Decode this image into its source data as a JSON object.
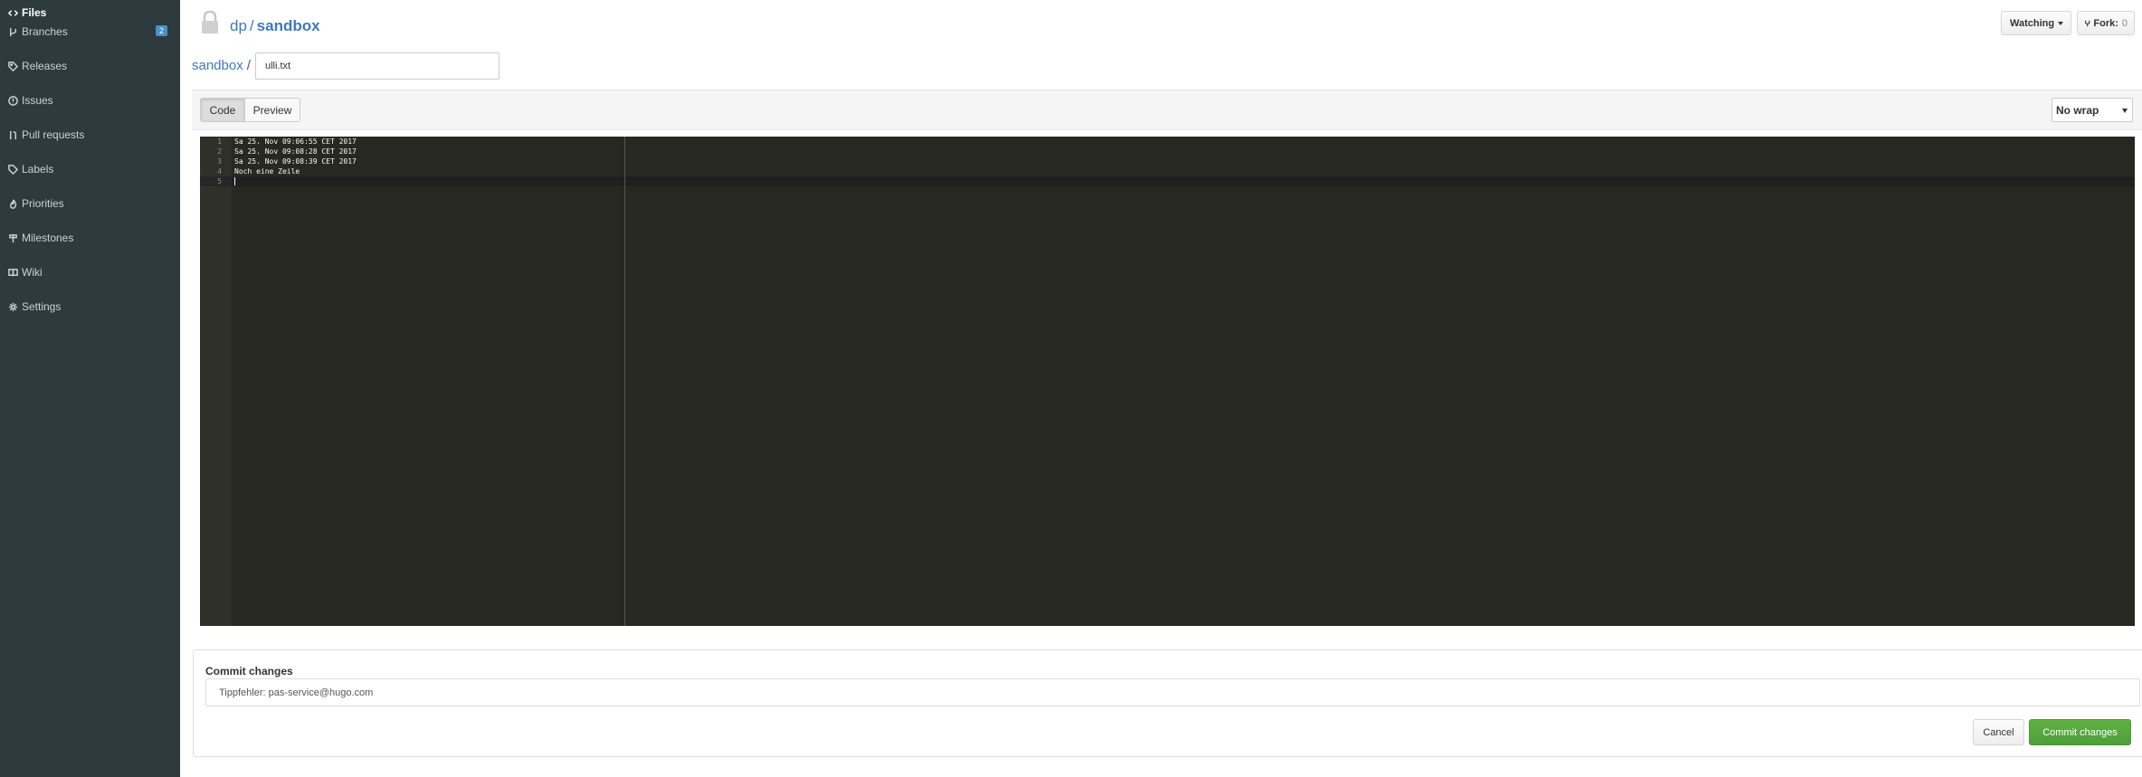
{
  "sidebar": {
    "items": [
      {
        "label": "Files",
        "icon": "code-icon",
        "active": true
      },
      {
        "label": "Branches",
        "icon": "branch-icon",
        "badge": "2"
      },
      {
        "label": "Releases",
        "icon": "tag-icon"
      },
      {
        "label": "Issues",
        "icon": "issue-icon"
      },
      {
        "label": "Pull requests",
        "icon": "pull-request-icon"
      },
      {
        "label": "Labels",
        "icon": "label-icon"
      },
      {
        "label": "Priorities",
        "icon": "flame-icon"
      },
      {
        "label": "Milestones",
        "icon": "milestone-icon"
      },
      {
        "label": "Wiki",
        "icon": "book-icon"
      },
      {
        "label": "Settings",
        "icon": "gear-icon"
      }
    ]
  },
  "header": {
    "owner": "dp",
    "separator": "/",
    "repo": "sandbox",
    "watch_label": "Watching",
    "fork_label": "Fork:",
    "fork_count": "0"
  },
  "file": {
    "breadcrumb_repo": "sandbox",
    "breadcrumb_sep": "/",
    "filename": "ulli.txt"
  },
  "toolbar": {
    "code_tab": "Code",
    "preview_tab": "Preview",
    "wrap_option": "No wrap"
  },
  "editor": {
    "lines": [
      {
        "num": "1",
        "text": "Sa 25. Nov 09:06:55 CET 2017"
      },
      {
        "num": "2",
        "text": "Sa 25. Nov 09:08:28 CET 2017"
      },
      {
        "num": "3",
        "text": "Sa 25. Nov 09:08:39 CET 2017"
      },
      {
        "num": "4",
        "text": "Noch eine Zeile"
      },
      {
        "num": "5",
        "text": ""
      }
    ]
  },
  "commit": {
    "title": "Commit changes",
    "message": "Tippfehler: pas-service@hugo.com",
    "cancel_label": "Cancel",
    "submit_label": "Commit changes"
  },
  "colors": {
    "sidebar_bg": "#2d3a3e",
    "link": "#4078c0",
    "editor_bg": "#272822",
    "commit_button": "#55a53e"
  }
}
